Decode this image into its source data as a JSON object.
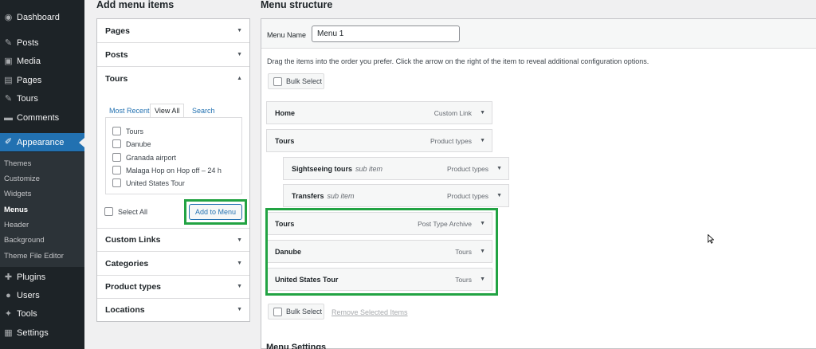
{
  "sidebar": {
    "items": [
      {
        "label": "Dashboard",
        "icon": "dashboard-icon",
        "glyph": "◉"
      },
      {
        "label": "Posts",
        "icon": "pin-icon",
        "glyph": "✎"
      },
      {
        "label": "Media",
        "icon": "media-icon",
        "glyph": "▣"
      },
      {
        "label": "Pages",
        "icon": "pages-icon",
        "glyph": "▤"
      },
      {
        "label": "Tours",
        "icon": "pin-icon",
        "glyph": "✎"
      },
      {
        "label": "Comments",
        "icon": "comment-icon",
        "glyph": "▬"
      },
      {
        "label": "Appearance",
        "icon": "brush-icon",
        "glyph": "✐"
      },
      {
        "label": "Plugins",
        "icon": "plugin-icon",
        "glyph": "✚"
      },
      {
        "label": "Users",
        "icon": "user-icon",
        "glyph": "●"
      },
      {
        "label": "Tools",
        "icon": "wrench-icon",
        "glyph": "✦"
      },
      {
        "label": "Settings",
        "icon": "settings-icon",
        "glyph": "▦"
      }
    ],
    "submenu": [
      "Themes",
      "Customize",
      "Widgets",
      "Menus",
      "Header",
      "Background",
      "Theme File Editor"
    ],
    "accent_color": "#2271b1"
  },
  "left": {
    "heading": "Add menu items",
    "sections": {
      "pages": "Pages",
      "posts": "Posts",
      "tours": "Tours",
      "custom_links": "Custom Links",
      "categories": "Categories",
      "product_types": "Product types",
      "locations": "Locations"
    },
    "tabs": {
      "most_recent": "Most Recent",
      "view_all": "View All",
      "search": "Search"
    },
    "checklist": [
      "Tours",
      "Danube",
      "Granada airport",
      "Malaga Hop on Hop off – 24 h",
      "United States Tour"
    ],
    "select_all": "Select All",
    "add_button": "Add to Menu"
  },
  "right": {
    "heading": "Menu structure",
    "menu_name_label": "Menu Name",
    "menu_name_value": "Menu 1",
    "instructions": "Drag the items into the order you prefer. Click the arrow on the right of the item to reveal additional configuration options.",
    "bulk_select": "Bulk Select",
    "remove_selected": "Remove Selected Items",
    "menu_settings": "Menu Settings",
    "items": [
      {
        "title": "Home",
        "sub": "",
        "type": "Custom Link"
      },
      {
        "title": "Tours",
        "sub": "",
        "type": "Product types"
      },
      {
        "title": "Sightseeing tours",
        "sub": "sub item",
        "type": "Product types"
      },
      {
        "title": "Transfers",
        "sub": "sub item",
        "type": "Product types"
      },
      {
        "title": "Tours",
        "sub": "",
        "type": "Post Type Archive"
      },
      {
        "title": "Danube",
        "sub": "",
        "type": "Tours"
      },
      {
        "title": "United States Tour",
        "sub": "",
        "type": "Tours"
      }
    ],
    "highlight_color": "#22a343"
  }
}
